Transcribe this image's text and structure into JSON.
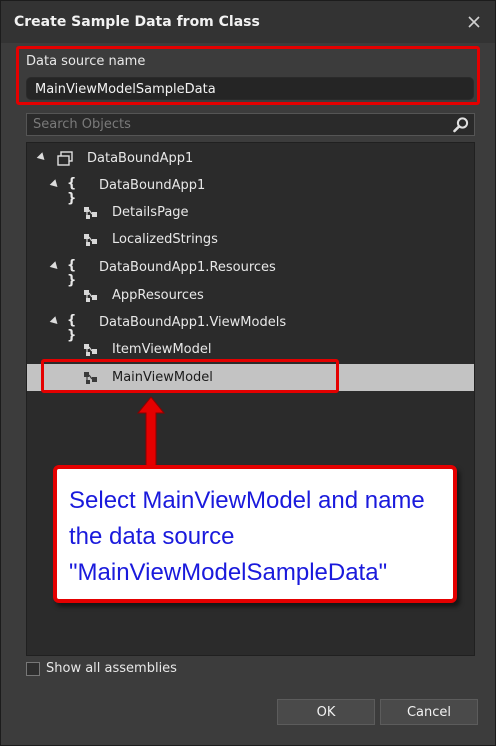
{
  "dialog": {
    "title": "Create Sample Data from Class",
    "close_icon": "close-icon"
  },
  "data_source": {
    "label": "Data source name",
    "value": "MainViewModelSampleData"
  },
  "search": {
    "placeholder": "Search Objects",
    "icon": "search-icon"
  },
  "tree": {
    "items": [
      {
        "label": "DataBoundApp1",
        "icon": "assembly-icon",
        "expanded": true,
        "level": 0
      },
      {
        "label": "DataBoundApp1",
        "icon": "namespace-icon",
        "expanded": true,
        "level": 1
      },
      {
        "label": "DetailsPage",
        "icon": "class-icon",
        "level": 2
      },
      {
        "label": "LocalizedStrings",
        "icon": "class-icon",
        "level": 2
      },
      {
        "label": "DataBoundApp1.Resources",
        "icon": "namespace-icon",
        "expanded": true,
        "level": 1
      },
      {
        "label": "AppResources",
        "icon": "class-icon",
        "level": 2
      },
      {
        "label": "DataBoundApp1.ViewModels",
        "icon": "namespace-icon",
        "expanded": true,
        "level": 1
      },
      {
        "label": "ItemViewModel",
        "icon": "class-icon",
        "level": 2
      },
      {
        "label": "MainViewModel",
        "icon": "class-icon",
        "level": 2,
        "selected": true
      }
    ]
  },
  "callout": {
    "text": "Select MainViewModel and name the data source \"MainViewModelSampleData\"",
    "text_color": "#1a1adc",
    "border_color": "#e40000"
  },
  "options": {
    "show_all_label": "Show all assemblies",
    "show_all_checked": false
  },
  "buttons": {
    "ok": "OK",
    "cancel": "Cancel"
  }
}
